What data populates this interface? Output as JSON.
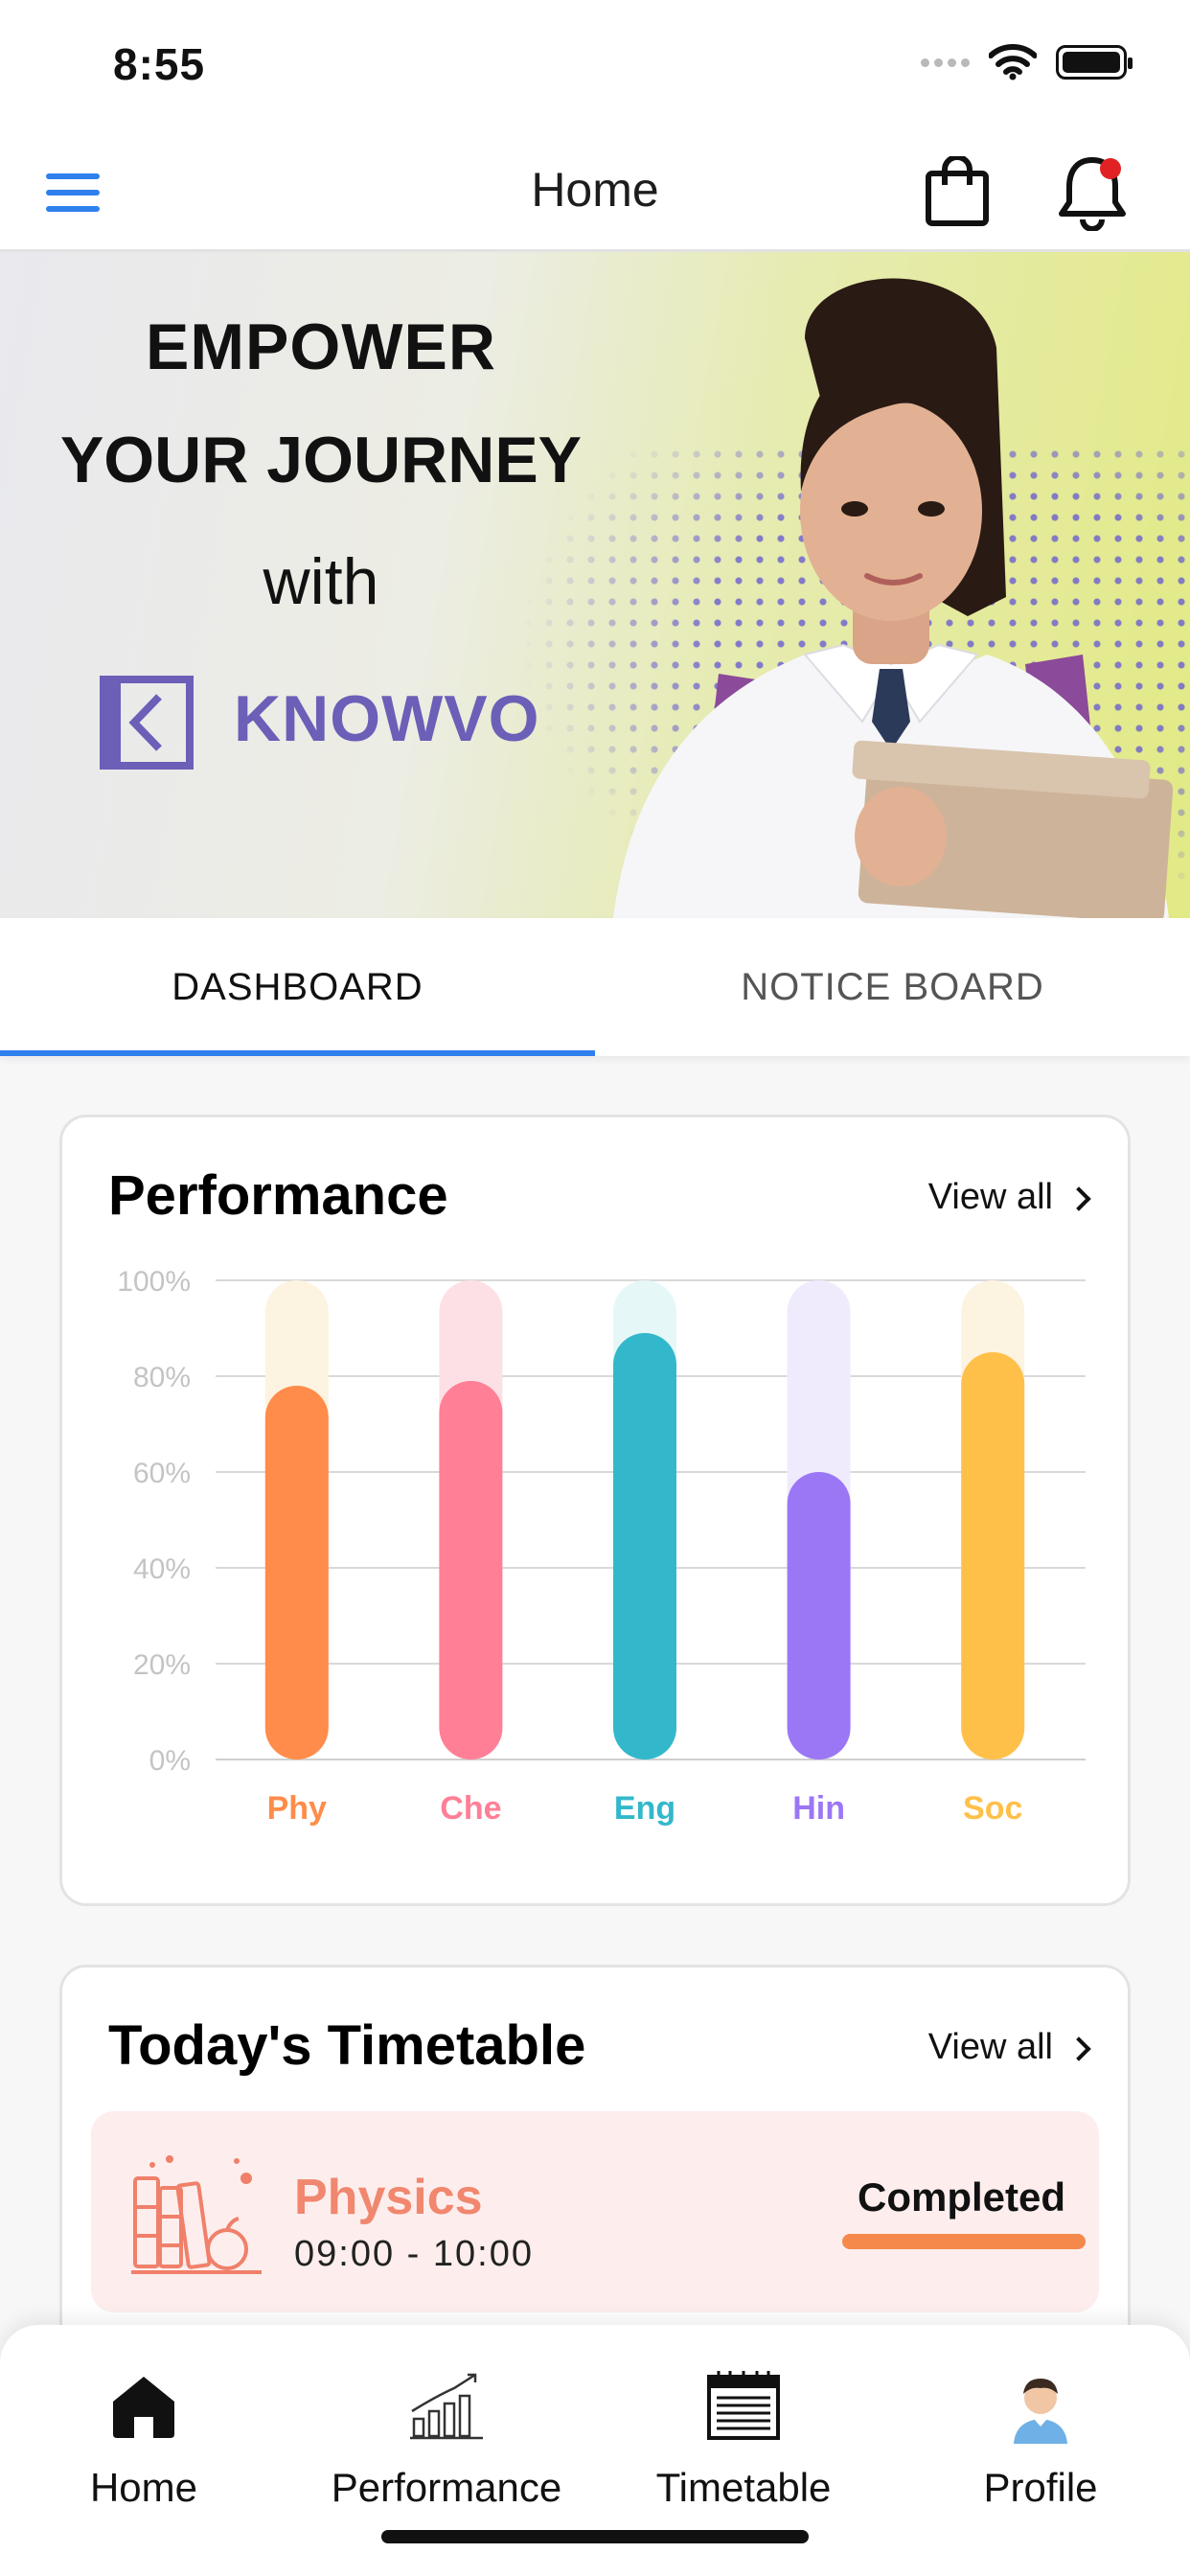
{
  "status_bar": {
    "time": "8:55"
  },
  "header": {
    "title": "Home"
  },
  "banner": {
    "line1": "EMPOWER",
    "line2": "YOUR JOURNEY",
    "line3": "with",
    "brand": "KNOWVO"
  },
  "tabs": [
    {
      "label": "DASHBOARD",
      "active": true
    },
    {
      "label": "NOTICE BOARD",
      "active": false
    }
  ],
  "performance": {
    "title": "Performance",
    "view_all": "View all"
  },
  "chart_data": {
    "type": "bar",
    "categories": [
      "Phy",
      "Che",
      "Eng",
      "Hin",
      "Soc"
    ],
    "values": [
      78,
      79,
      89,
      60,
      85
    ],
    "ylim": [
      0,
      100
    ],
    "yticks": [
      "0%",
      "20%",
      "40%",
      "60%",
      "80%",
      "100%"
    ],
    "colors": [
      "#ff8c4a",
      "#ff7f96",
      "#33b8cb",
      "#9b77f5",
      "#ffc04a"
    ],
    "track_colors": [
      "#fdf3e1",
      "#fde0e5",
      "#e6f7f8",
      "#efebfd",
      "#fdf3e1"
    ],
    "grid": true
  },
  "timetable": {
    "title": "Today's Timetable",
    "view_all": "View all",
    "items": [
      {
        "subject": "Physics",
        "time": "09:00  -  10:00",
        "status": "Completed"
      }
    ]
  },
  "bottom_nav": [
    {
      "label": "Home",
      "icon": "home-icon"
    },
    {
      "label": "Performance",
      "icon": "performance-chart-icon"
    },
    {
      "label": "Timetable",
      "icon": "timetable-icon"
    },
    {
      "label": "Profile",
      "icon": "profile-avatar"
    }
  ]
}
